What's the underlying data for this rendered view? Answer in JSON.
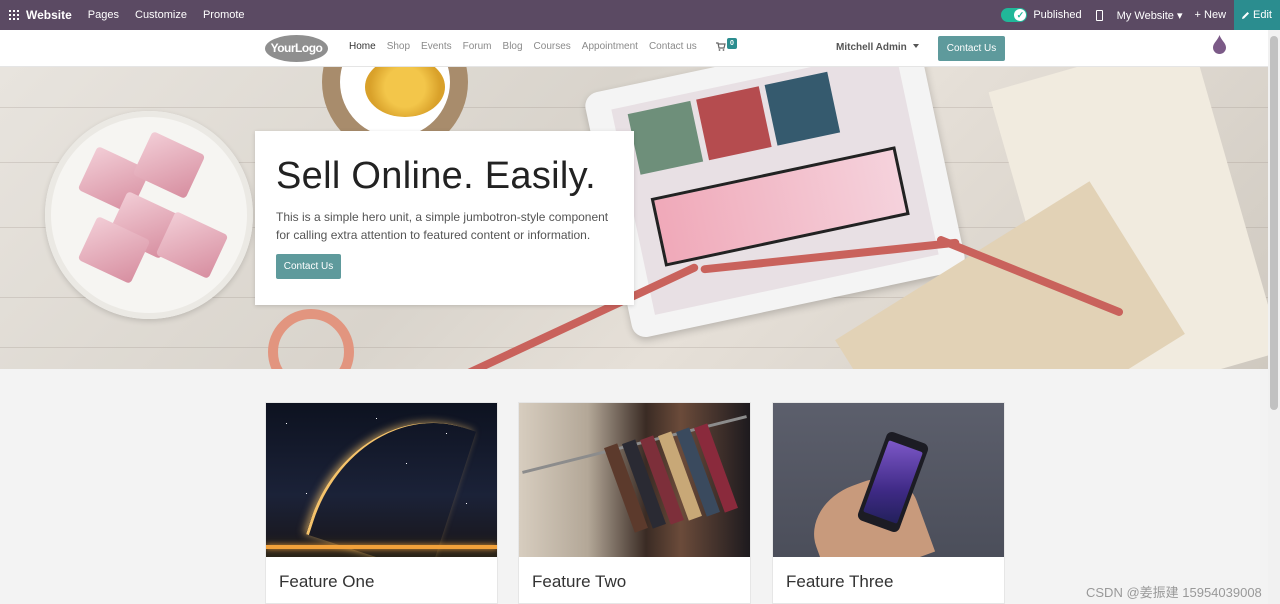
{
  "adminbar": {
    "brand": "Website",
    "menu": [
      "Pages",
      "Customize",
      "Promote"
    ],
    "published_label": "Published",
    "site_label": "My Website",
    "new_label": "+ New",
    "edit_label": "Edit"
  },
  "nav": {
    "logo": "YourLogo",
    "links": [
      "Home",
      "Shop",
      "Events",
      "Forum",
      "Blog",
      "Courses",
      "Appointment",
      "Contact us"
    ],
    "cart_count": "0",
    "user": "Mitchell Admin",
    "contact_button": "Contact Us"
  },
  "hero": {
    "title": "Sell Online. Easily.",
    "text": "This is a simple hero unit, a simple jumbotron-style component for calling extra attention to featured content or information.",
    "button": "Contact Us"
  },
  "features": [
    {
      "title": "Feature One"
    },
    {
      "title": "Feature Two"
    },
    {
      "title": "Feature Three"
    }
  ],
  "watermark": "CSDN @姜振建  15954039008",
  "colors": {
    "adminbar": "#5b4a63",
    "accent": "#5e9a9c",
    "toggle_on": "#21b799"
  }
}
